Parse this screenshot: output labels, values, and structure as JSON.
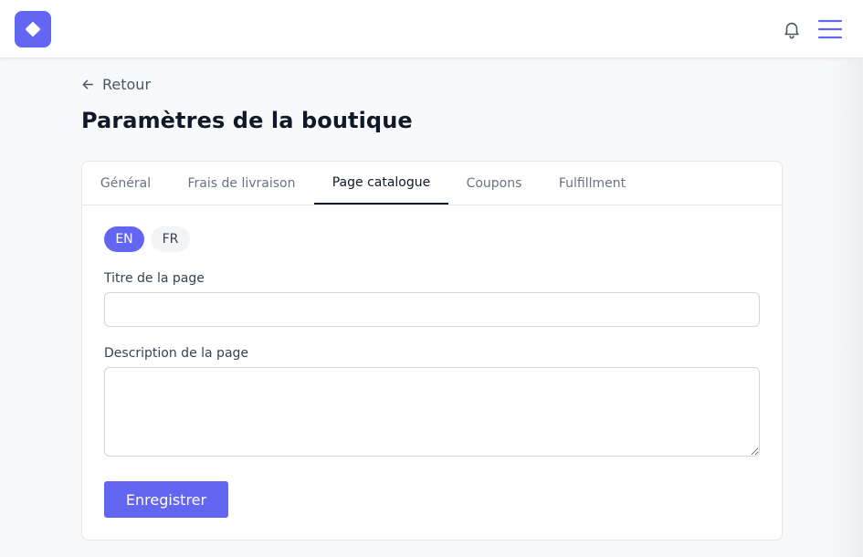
{
  "header": {
    "logo_icon": "diamond-logo-icon",
    "notifications_icon": "bell-icon",
    "menu_icon": "hamburger-menu-icon",
    "accent_color": "#6366f1"
  },
  "back_link": {
    "label": "Retour",
    "icon": "arrow-left-icon"
  },
  "page_title": "Paramètres de la boutique",
  "tabs": [
    {
      "label": "Général",
      "active": false
    },
    {
      "label": "Frais de livraison",
      "active": false
    },
    {
      "label": "Page catalogue",
      "active": true
    },
    {
      "label": "Coupons",
      "active": false
    },
    {
      "label": "Fulfillment",
      "active": false
    }
  ],
  "languages": [
    {
      "label": "EN",
      "selected": true
    },
    {
      "label": "FR",
      "selected": false
    }
  ],
  "form": {
    "title_label": "Titre de la page",
    "title_value": "",
    "description_label": "Description de la page",
    "description_value": "",
    "save_label": "Enregistrer"
  }
}
